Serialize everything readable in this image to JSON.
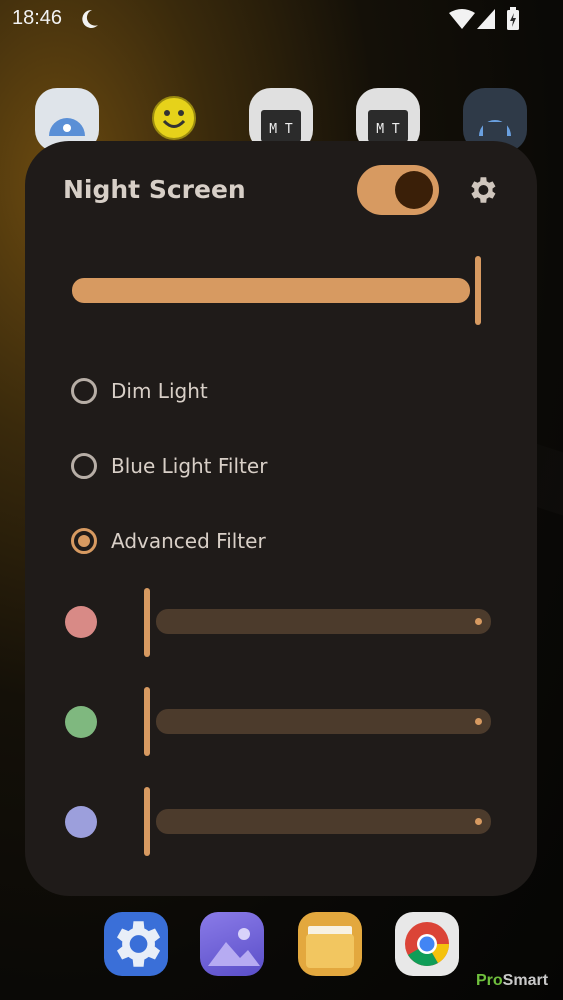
{
  "status_bar": {
    "time": "18:46",
    "icons": [
      "moon-icon",
      "wifi-icon",
      "signal-icon",
      "battery-charging-icon"
    ]
  },
  "home": {
    "icons": [
      "android-settings-app-icon",
      "smiley-app-icon",
      "mt-manager-app-icon",
      "mt-manager-2-app-icon",
      "android-terminal-app-icon"
    ]
  },
  "panel": {
    "title": "Night Screen",
    "toggle_on": true,
    "main_slider_fraction": 0.99,
    "options": [
      {
        "label": "Dim Light",
        "checked": false
      },
      {
        "label": "Blue Light Filter",
        "checked": false
      },
      {
        "label": "Advanced Filter",
        "checked": true
      }
    ],
    "filters": [
      {
        "channel": "red",
        "color": "#d88a86",
        "fraction": 0.0
      },
      {
        "channel": "green",
        "color": "#7fb87f",
        "fraction": 0.0
      },
      {
        "channel": "blue",
        "color": "#9c9fdc",
        "fraction": 0.0
      }
    ],
    "accent": "#d79a61"
  },
  "dock": {
    "icons": [
      "settings-app-icon",
      "gallery-app-icon",
      "files-app-icon",
      "chrome-app-icon"
    ]
  },
  "watermark": {
    "pro": "Pro",
    "smart": "Smart"
  }
}
